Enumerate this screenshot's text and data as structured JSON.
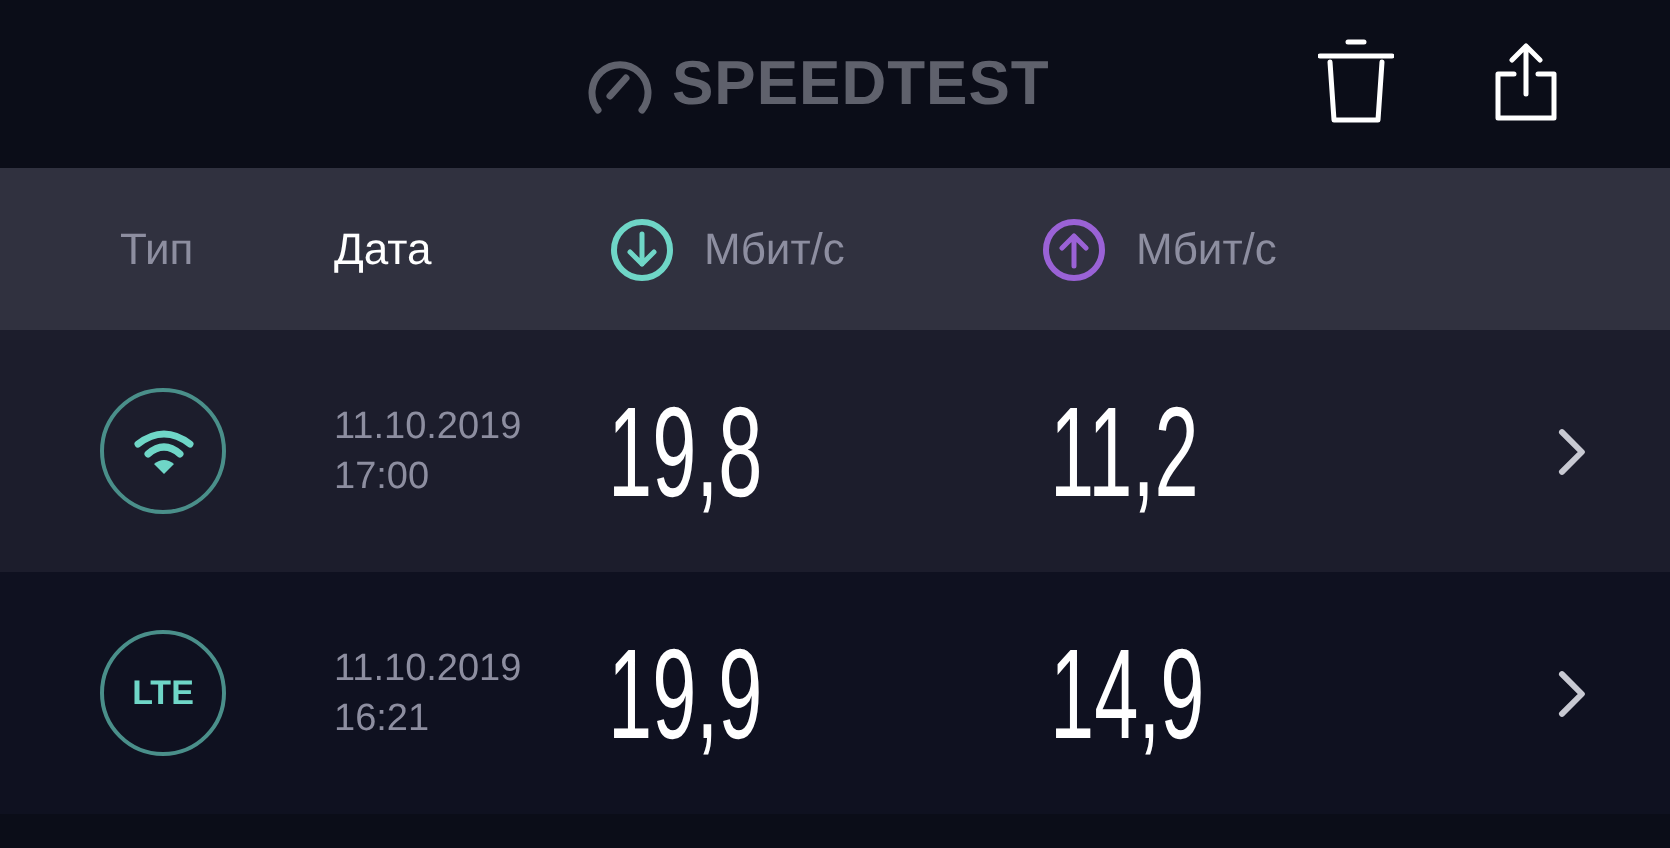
{
  "header": {
    "logo": "SPEEDTEST"
  },
  "columns": [
    {
      "label": "Тип",
      "kind": "text",
      "selected": false
    },
    {
      "label": "Дата",
      "kind": "text",
      "selected": true
    },
    {
      "label": "Мбит/с",
      "kind": "download",
      "selected": false
    },
    {
      "label": "Мбит/с",
      "kind": "upload",
      "selected": false
    }
  ],
  "rows": [
    {
      "kind": "wifi",
      "date": "11.10.2019",
      "time": "17:00",
      "download": "19,8",
      "upload": "11,2",
      "selected": true
    },
    {
      "kind": "lte",
      "type_label": "LTE",
      "date": "11.10.2019",
      "time": "16:21",
      "download": "19,9",
      "upload": "14,9",
      "selected": false
    }
  ]
}
